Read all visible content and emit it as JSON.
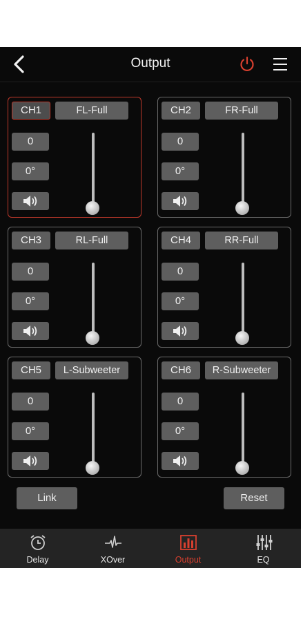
{
  "header": {
    "title": "Output",
    "back_icon": "chevron-left-icon",
    "power_icon": "power-icon",
    "menu_icon": "hamburger-menu-icon",
    "accent": "#d8402f"
  },
  "channels": [
    {
      "ch": "CH1",
      "name": "FL-Full",
      "gain": "0",
      "phase": "0°",
      "active": true
    },
    {
      "ch": "CH2",
      "name": "FR-Full",
      "gain": "0",
      "phase": "0°",
      "active": false
    },
    {
      "ch": "CH3",
      "name": "RL-Full",
      "gain": "0",
      "phase": "0°",
      "active": false
    },
    {
      "ch": "CH4",
      "name": "RR-Full",
      "gain": "0",
      "phase": "0°",
      "active": false
    },
    {
      "ch": "CH5",
      "name": "L-Subweeter",
      "gain": "0",
      "phase": "0°",
      "active": false
    },
    {
      "ch": "CH6",
      "name": "R-Subweeter",
      "gain": "0",
      "phase": "0°",
      "active": false
    }
  ],
  "actions": {
    "link": "Link",
    "reset": "Reset"
  },
  "tabs": [
    {
      "label": "Delay",
      "icon": "alarm-clock-icon"
    },
    {
      "label": "XOver",
      "icon": "waveform-icon"
    },
    {
      "label": "Output",
      "icon": "bar-chart-icon",
      "active": true
    },
    {
      "label": "EQ",
      "icon": "equalizer-sliders-icon"
    }
  ]
}
